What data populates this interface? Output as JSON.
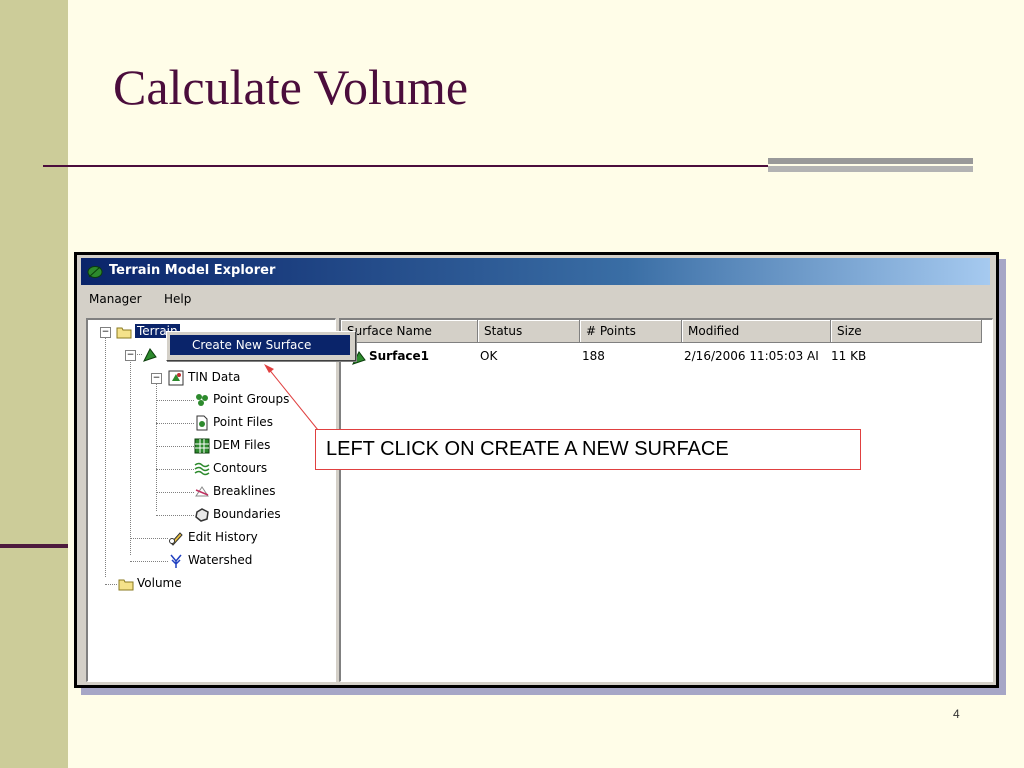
{
  "slide": {
    "title": "Calculate Volume",
    "page_number": "4",
    "colors": {
      "background": "#fffde8",
      "band": "#cccc99",
      "title": "#4b0d3c"
    }
  },
  "window": {
    "title": "Terrain Model Explorer",
    "menu": [
      "Manager",
      "Help"
    ]
  },
  "tree": {
    "nodes": [
      {
        "label": "Terrain",
        "icon": "folder-open-icon"
      },
      {
        "label": "",
        "icon": "surface-icon"
      },
      {
        "label": "TIN Data",
        "icon": "tin-data-icon"
      },
      {
        "label": "Point Groups",
        "icon": "point-groups-icon"
      },
      {
        "label": "Point Files",
        "icon": "point-files-icon"
      },
      {
        "label": "DEM Files",
        "icon": "dem-files-icon"
      },
      {
        "label": "Contours",
        "icon": "contours-icon"
      },
      {
        "label": "Breaklines",
        "icon": "breaklines-icon"
      },
      {
        "label": "Boundaries",
        "icon": "boundaries-icon"
      },
      {
        "label": "Edit History",
        "icon": "edit-history-icon"
      },
      {
        "label": "Watershed",
        "icon": "watershed-icon"
      },
      {
        "label": "Volume",
        "icon": "folder-icon"
      }
    ]
  },
  "context_menu": {
    "items": [
      "Create New Surface"
    ]
  },
  "list": {
    "columns": [
      "Surface Name",
      "Status",
      "# Points",
      "Modified",
      "Size"
    ],
    "rows": [
      {
        "name": "Surface1",
        "status": "OK",
        "points": "188",
        "modified": "2/16/2006 11:05:03 AI",
        "size": "11 KB"
      }
    ]
  },
  "annotation": {
    "text": "LEFT CLICK ON CREATE A NEW SURFACE"
  }
}
